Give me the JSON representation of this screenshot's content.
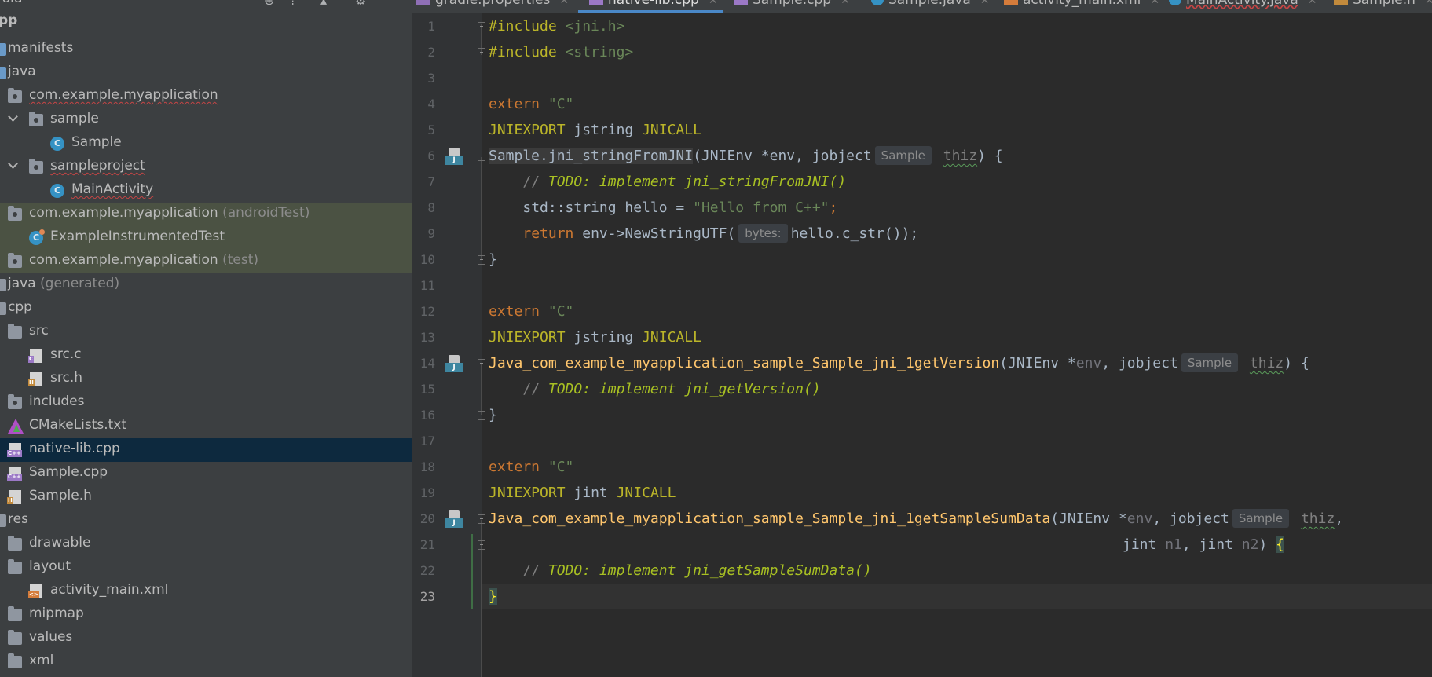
{
  "tree": {
    "header": {
      "title": "roid"
    },
    "items": [
      {
        "label": "pp",
        "icon": "android-module-icon"
      },
      {
        "label": "manifests",
        "icon": "folder-icon"
      },
      {
        "label": "java",
        "icon": "folder-icon"
      },
      {
        "label": "com.example.myapplication",
        "icon": "package-icon"
      },
      {
        "label": "sample",
        "icon": "package-icon"
      },
      {
        "label": "Sample",
        "icon": "class-icon"
      },
      {
        "label": "sampleproject",
        "icon": "package-icon"
      },
      {
        "label": "MainActivity",
        "icon": "class-icon"
      },
      {
        "label": "com.example.myapplication",
        "suffix": "(androidTest)",
        "icon": "package-icon"
      },
      {
        "label": "ExampleInstrumentedTest",
        "icon": "test-class-icon"
      },
      {
        "label": "com.example.myapplication",
        "suffix": "(test)",
        "icon": "package-icon"
      },
      {
        "label": "java",
        "suffix": "(generated)",
        "icon": "folder-icon"
      },
      {
        "label": "cpp",
        "icon": "folder-icon"
      },
      {
        "label": "src",
        "icon": "folder-icon"
      },
      {
        "label": "src.c",
        "icon": "c-file-icon"
      },
      {
        "label": "src.h",
        "icon": "h-file-icon"
      },
      {
        "label": "includes",
        "icon": "folder-icon"
      },
      {
        "label": "CMakeLists.txt",
        "icon": "cmake-icon"
      },
      {
        "label": "native-lib.cpp",
        "icon": "cpp-file-icon"
      },
      {
        "label": "Sample.cpp",
        "icon": "cpp-file-icon"
      },
      {
        "label": "Sample.h",
        "icon": "h-file-icon"
      },
      {
        "label": "res",
        "icon": "folder-icon"
      },
      {
        "label": "drawable",
        "icon": "folder-icon"
      },
      {
        "label": "layout",
        "icon": "folder-icon"
      },
      {
        "label": "activity_main.xml",
        "icon": "xml-file-icon"
      },
      {
        "label": "mipmap",
        "icon": "folder-icon"
      },
      {
        "label": "values",
        "icon": "folder-icon"
      },
      {
        "label": "xml",
        "icon": "folder-icon"
      }
    ]
  },
  "tabs": [
    {
      "label": "gradle.properties",
      "icon": "gradle-icon"
    },
    {
      "label": "native-lib.cpp",
      "icon": "cpp-file-icon",
      "active": true
    },
    {
      "label": "Sample.cpp",
      "icon": "cpp-file-icon"
    },
    {
      "label": "Sample.java",
      "icon": "class-icon"
    },
    {
      "label": "activity_main.xml",
      "icon": "xml-file-icon"
    },
    {
      "label": "MainActivity.java",
      "icon": "class-icon"
    },
    {
      "label": "Sample.h",
      "icon": "h-file-icon"
    }
  ],
  "editor": {
    "line_numbers": [
      "1",
      "2",
      "3",
      "4",
      "5",
      "6",
      "7",
      "8",
      "9",
      "10",
      "11",
      "12",
      "13",
      "14",
      "15",
      "16",
      "17",
      "18",
      "19",
      "20",
      "21",
      "22",
      "23"
    ],
    "code": {
      "l1_pp": "#include",
      "l1_hdr": "<jni.h>",
      "l2_pp": "#include",
      "l2_hdr": "<string>",
      "l4_kw": "extern",
      "l4_str": "\"C\"",
      "l5_mac": "JNIEXPORT",
      "l5_type": "jstring",
      "l5_mac2": "JNICALL",
      "l6_fn": "Sample.jni_stringFromJNI",
      "l6_args": "(JNIEnv *env, jobject",
      "l6_hint": "Sample",
      "l6_param": "thiz",
      "l6_end": ") {",
      "l7_cmt": "// ",
      "l7_todo": "TODO: implement jni_stringFromJNI()",
      "l8_code": "std::string hello = ",
      "l8_str": "\"Hello from C++\"",
      "l8_end": ";",
      "l9_kw": "return",
      "l9_code": " env->NewStringUTF(",
      "l9_hint": "bytes:",
      "l9_arg": "hello.c_str());",
      "l10": "}",
      "l12_kw": "extern",
      "l12_str": "\"C\"",
      "l13_mac": "JNIEXPORT",
      "l13_type": "jstring",
      "l13_mac2": "JNICALL",
      "l14_fn": "Java_com_example_myapplication_sample_Sample_jni_1getVersion",
      "l14_args": "(JNIEnv *",
      "l14_env": "env",
      "l14_mid": ", jobject",
      "l14_hint": "Sample",
      "l14_param": "thiz",
      "l14_end": ") {",
      "l15_cmt": "// ",
      "l15_todo": "TODO: implement jni_getVersion()",
      "l16": "}",
      "l18_kw": "extern",
      "l18_str": "\"C\"",
      "l19_mac": "JNIEXPORT",
      "l19_type": "jint",
      "l19_mac2": "JNICALL",
      "l20_fn": "Java_com_example_myapplication_sample_Sample_jni_1getSampleSumData",
      "l20_args": "(JNIEnv *",
      "l20_env": "env",
      "l20_mid": ", jobject",
      "l20_hint": "Sample",
      "l20_param": "thiz",
      "l20_end": ",",
      "l21_t1": "jint ",
      "l21_n1": "n1",
      "l21_mid": ", jint ",
      "l21_n2": "n2",
      "l21_end": ") ",
      "l21_brace": "{",
      "l22_cmt": "// ",
      "l22_todo": "TODO: implement jni_getSampleSumData()",
      "l23": "}"
    }
  },
  "colors": {
    "keyword": "#cc7832",
    "macro": "#bbb529",
    "string": "#6a8759",
    "function": "#ffc66d",
    "todo": "#a8c023",
    "selection": "#0d293e"
  }
}
